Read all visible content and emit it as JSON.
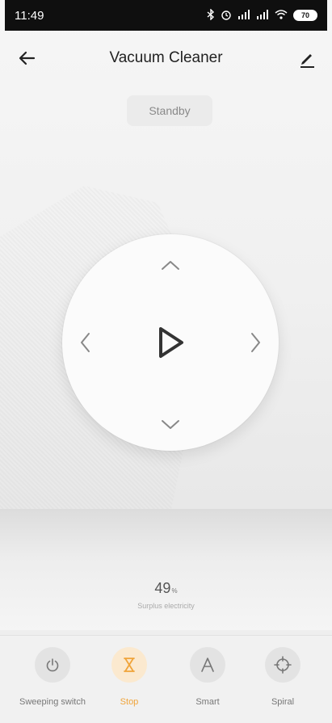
{
  "status_bar": {
    "time": "11:49",
    "battery_level": "70"
  },
  "app_bar": {
    "title": "Vacuum Cleaner"
  },
  "status_chip": {
    "label": "Standby"
  },
  "battery_readout": {
    "value": "49",
    "unit": "%",
    "label": "Surplus electricity"
  },
  "actions": [
    {
      "label": "Sweeping switch",
      "icon": "power-icon",
      "active": false
    },
    {
      "label": "Stop",
      "icon": "hourglass-icon",
      "active": true
    },
    {
      "label": "Smart",
      "icon": "letter-a-icon",
      "active": false
    },
    {
      "label": "Spiral",
      "icon": "spiral-target-icon",
      "active": false
    }
  ],
  "colors": {
    "accent": "#f0a43a",
    "status_bar": "#0f0f0f"
  }
}
